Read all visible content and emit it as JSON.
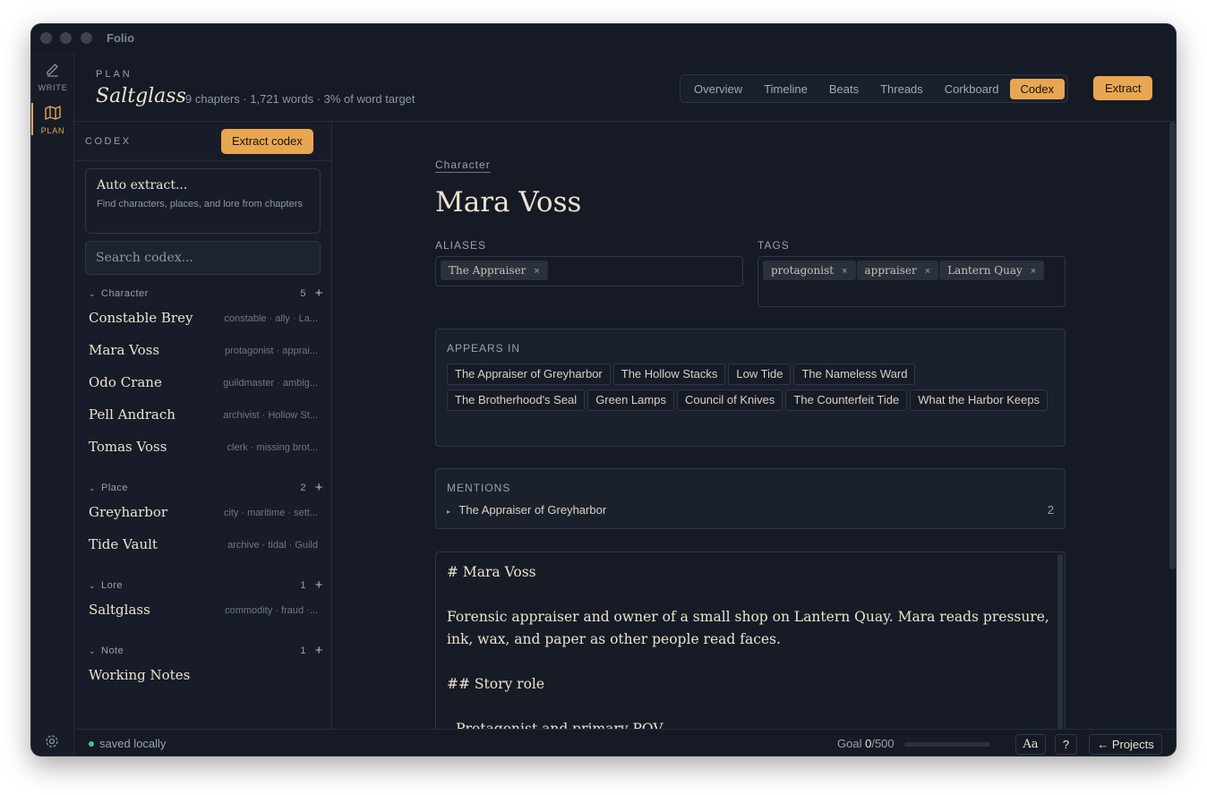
{
  "app": {
    "title": "Folio"
  },
  "rail": {
    "write": "WRITE",
    "plan": "PLAN",
    "settings_icon": "gear-icon"
  },
  "header": {
    "kicker": "PLAN",
    "project_title": "Saltglass",
    "meta": "9 chapters · 1,721 words · 3% of word target",
    "tabs": [
      "Overview",
      "Timeline",
      "Beats",
      "Threads",
      "Corkboard",
      "Codex"
    ],
    "active_tab": "Codex",
    "extract_label": "Extract"
  },
  "sidebar": {
    "kicker": "CODEX",
    "extract_codex_label": "Extract codex",
    "auto": {
      "title": "Auto extract...",
      "description": "Find characters, places, and lore from chapters"
    },
    "search_placeholder": "Search codex...",
    "groups": [
      {
        "name": "Character",
        "count": "5",
        "entries": [
          {
            "name": "Constable Brey",
            "tags": "constable · ally · La..."
          },
          {
            "name": "Mara Voss",
            "tags": "protagonist · apprai..."
          },
          {
            "name": "Odo Crane",
            "tags": "guildmaster · ambig..."
          },
          {
            "name": "Pell Andrach",
            "tags": "archivist · Hollow St..."
          },
          {
            "name": "Tomas Voss",
            "tags": "clerk · missing brot..."
          }
        ]
      },
      {
        "name": "Place",
        "count": "2",
        "entries": [
          {
            "name": "Greyharbor",
            "tags": "city · maritime · sett..."
          },
          {
            "name": "Tide Vault",
            "tags": "archive · tidal · Guild"
          }
        ]
      },
      {
        "name": "Lore",
        "count": "1",
        "entries": [
          {
            "name": "Saltglass",
            "tags": "commodity · fraud ·..."
          }
        ]
      },
      {
        "name": "Note",
        "count": "1",
        "entries": [
          {
            "name": "Working Notes",
            "tags": ""
          }
        ]
      }
    ]
  },
  "detail": {
    "type": "Character",
    "title": "Mara Voss",
    "aliases_label": "ALIASES",
    "aliases": [
      "The Appraiser"
    ],
    "tags_label": "TAGS",
    "tags": [
      "protagonist",
      "appraiser",
      "Lantern Quay"
    ],
    "remove_glyph": "×",
    "appears_label": "APPEARS IN",
    "appears_in": [
      "The Appraiser of Greyharbor",
      "The Hollow Stacks",
      "Low Tide",
      "The Nameless Ward",
      "The Brotherhood's Seal",
      "Green Lamps",
      "Council of Knives",
      "The Counterfeit Tide",
      "What the Harbor Keeps"
    ],
    "mentions_label": "MENTIONS",
    "mentions": [
      {
        "title": "The Appraiser of Greyharbor",
        "count": "2"
      }
    ],
    "editor": {
      "heading": "# Mara Voss",
      "paragraph": "Forensic appraiser and owner of a small shop on Lantern Quay. Mara reads pressure, ink, wax, and paper as other people read faces.",
      "subheading": "## Story role",
      "list_item": "- Protagonist and primary POV"
    }
  },
  "status": {
    "saved": "saved locally",
    "goal_label": "Goal",
    "goal_current": "0",
    "goal_total": "/500",
    "goal_fraction": 0.0,
    "font_button": "Aa",
    "help_button": "?",
    "projects_button": "← Projects"
  },
  "colors": {
    "accent": "#e8a653",
    "saved_dot": "#3fc79a",
    "background": "#151a25"
  }
}
